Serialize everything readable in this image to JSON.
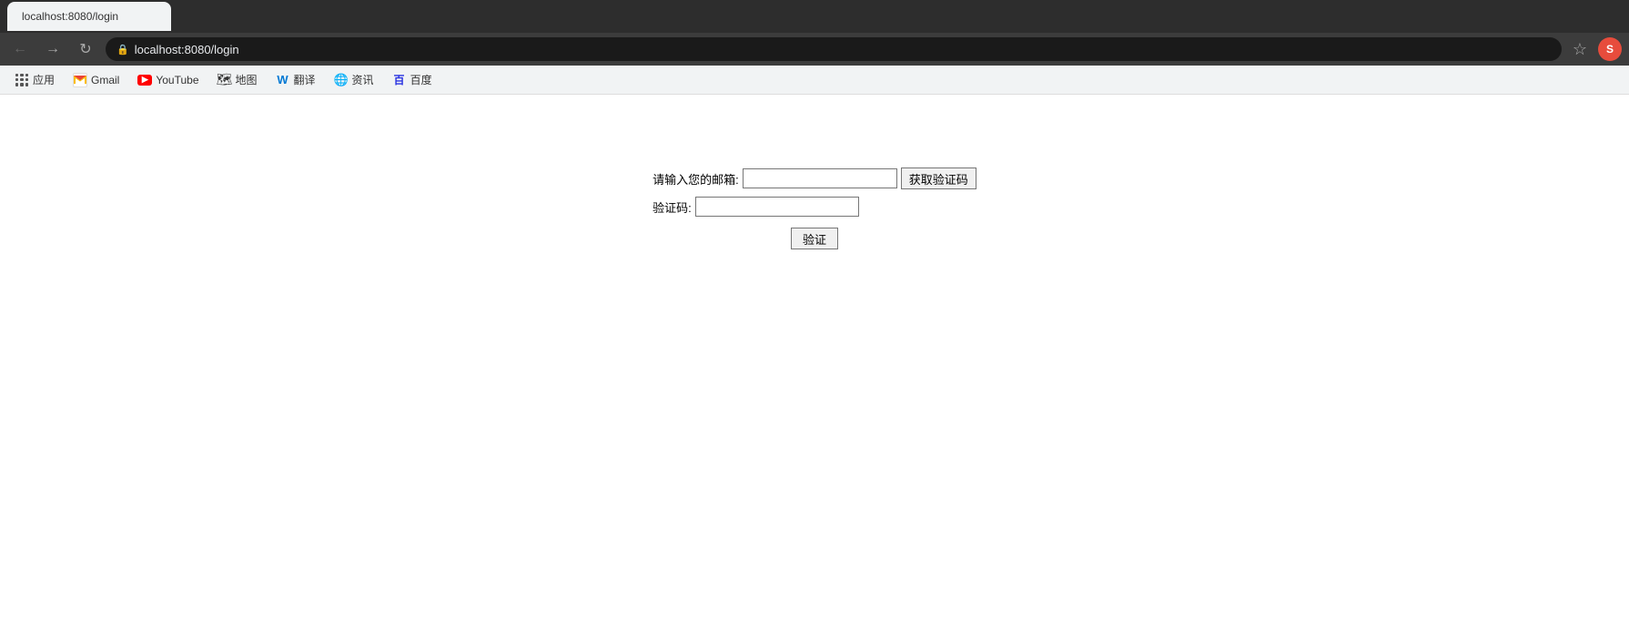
{
  "browser": {
    "tab": {
      "title": "localhost:8080/login"
    },
    "address": "localhost:8080/login",
    "nav": {
      "back_label": "←",
      "forward_label": "→",
      "refresh_label": "↻"
    },
    "star_icon": "☆",
    "profile_initial": "S"
  },
  "bookmarks": [
    {
      "id": "apps",
      "label": "应用",
      "icon_type": "apps"
    },
    {
      "id": "gmail",
      "label": "Gmail",
      "icon_type": "gmail"
    },
    {
      "id": "youtube",
      "label": "YouTube",
      "icon_type": "youtube"
    },
    {
      "id": "maps",
      "label": "地图",
      "icon_type": "maps"
    },
    {
      "id": "translate-msn",
      "label": "翻译",
      "icon_type": "msn"
    },
    {
      "id": "news",
      "label": "资讯",
      "icon_type": "news"
    },
    {
      "id": "baidu",
      "label": "百度",
      "icon_type": "baidu"
    }
  ],
  "page": {
    "email_label": "请输入您的邮箱:",
    "email_placeholder": "",
    "get_code_btn": "获取验证码",
    "code_label": "验证码:",
    "code_placeholder": "",
    "verify_btn": "验证"
  }
}
